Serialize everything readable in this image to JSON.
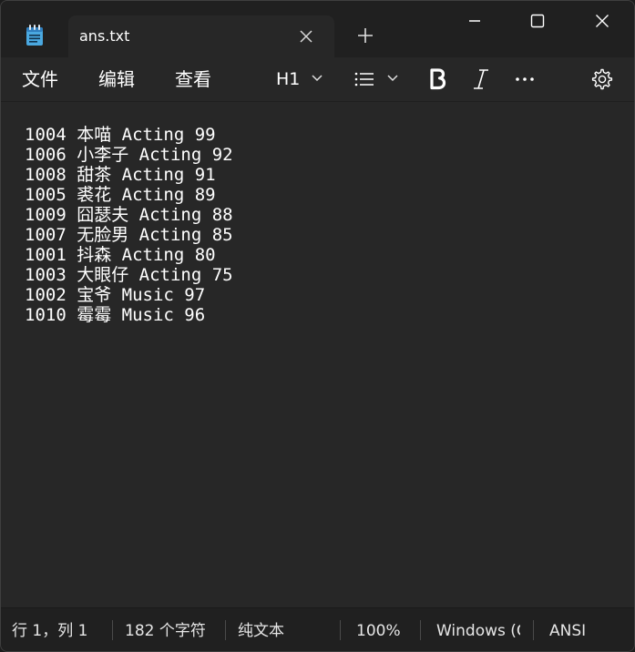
{
  "titlebar": {
    "tab_title": "ans.txt",
    "app_icon": "notepad-icon",
    "close_tab_icon": "close-icon",
    "new_tab_icon": "plus-icon",
    "window_controls": [
      "minimize-icon",
      "maximize-icon",
      "close-icon"
    ]
  },
  "menu": {
    "file": "文件",
    "edit": "编辑",
    "view": "查看"
  },
  "toolbar": {
    "heading": "H1",
    "heading_icon": "chevron-down-icon",
    "list_icon": "list-icon",
    "bold_icon": "bold-icon",
    "italic_icon": "italic-icon",
    "more_icon": "more-icon",
    "settings_icon": "gear-icon"
  },
  "editor": {
    "lines": [
      "1004 本喵 Acting 99",
      "1006 小李子 Acting 92",
      "1008 甜茶 Acting 91",
      "1005 裘花 Acting 89",
      "1009 囧瑟夫 Acting 88",
      "1007 无脸男 Acting 85",
      "1001 抖森 Acting 80",
      "1003 大眼仔 Acting 75",
      "1002 宝爷 Music 97",
      "1010 霉霉 Music 96"
    ]
  },
  "status": {
    "position": "行 1，列 1",
    "char_count": "182 个字符",
    "format": "纯文本",
    "zoom": "100%",
    "line_ending": "Windows (C",
    "encoding": "ANSI"
  },
  "colors": {
    "titlebar_bg": "#202020",
    "editor_bg": "#272727",
    "text": "#ffffff",
    "notepad_icon_blue": "#4aa8e0"
  }
}
